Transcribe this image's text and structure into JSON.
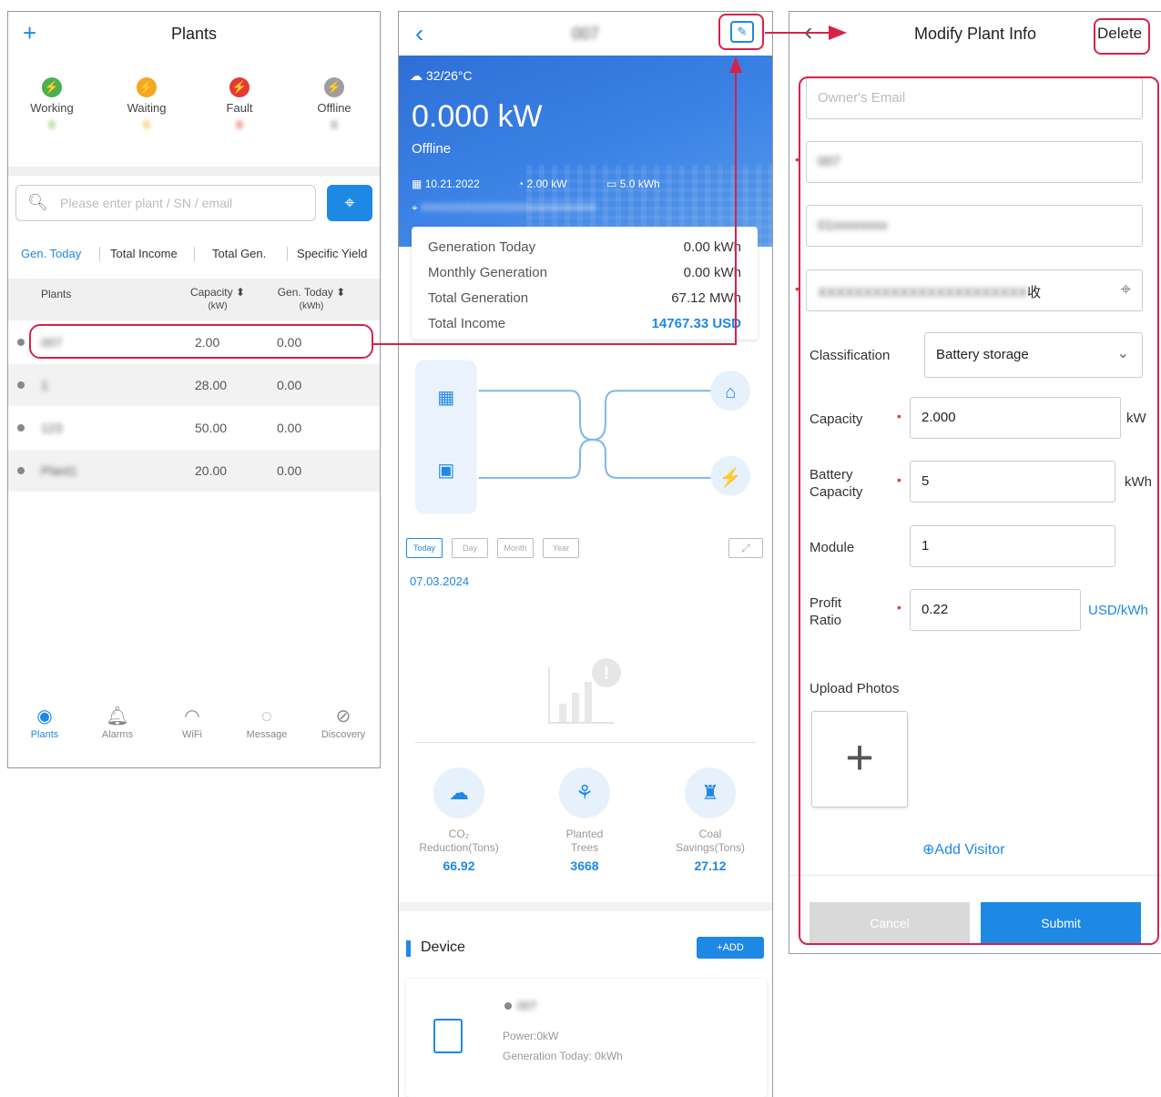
{
  "panel1": {
    "title": "Plants",
    "add_icon": "plus-icon",
    "statuses": [
      {
        "label": "Working",
        "color": "#4caf50",
        "glyph": "⚡"
      },
      {
        "label": "Waiting",
        "color": "#f5a623",
        "glyph": "⚡"
      },
      {
        "label": "Fault",
        "color": "#e53935",
        "glyph": "⚡"
      },
      {
        "label": "Offline",
        "color": "#9e9e9e",
        "glyph": "⚡"
      }
    ],
    "search_placeholder": "Please enter plant / SN / email",
    "tabs": [
      "Gen. Today",
      "Total Income",
      "Total Gen.",
      "Specific Yield"
    ],
    "columns": {
      "plants": "Plants",
      "capacity": "Capacity ⬍",
      "capacity_unit": "(kW)",
      "gen_today": "Gen. Today ⬍",
      "gen_unit": "(kWh)"
    },
    "rows": [
      {
        "name": "007",
        "capacity": "2.00",
        "gen": "0.00"
      },
      {
        "name": "1",
        "capacity": "28.00",
        "gen": "0.00"
      },
      {
        "name": "123",
        "capacity": "50.00",
        "gen": "0.00"
      },
      {
        "name": "Plant1",
        "capacity": "20.00",
        "gen": "0.00"
      }
    ],
    "nav": [
      "Plants",
      "Alarms",
      "WiFi",
      "Message",
      "Discovery"
    ]
  },
  "panel2": {
    "plant_name": "007",
    "weather": "32/26°C",
    "power": "0.000 kW",
    "status": "Offline",
    "date": "10.21.2022",
    "capacity": "2.00 kW",
    "battery": "5.0 kWh",
    "address": "XXXXXXXXXXXXXXXXXXXXXXXX",
    "stats": [
      {
        "label": "Generation Today",
        "value": "0.00 kWh"
      },
      {
        "label": "Monthly Generation",
        "value": "0.00 kWh"
      },
      {
        "label": "Total Generation",
        "value": "67.12 MWh"
      },
      {
        "label": "Total Income",
        "value": "14767.33 USD"
      }
    ],
    "chips": [
      "Today",
      "Day",
      "Month",
      "Year"
    ],
    "chart_date": "07.03.2024",
    "env": [
      {
        "label1": "CO₂",
        "label2": "Reduction(Tons)",
        "value": "66.92"
      },
      {
        "label1": "Planted",
        "label2": "Trees",
        "value": "3668"
      },
      {
        "label1": "Coal",
        "label2": "Savings(Tons)",
        "value": "27.12"
      }
    ],
    "device_title": "Device",
    "add_label": "ADD",
    "device_name": "007",
    "device_power": "Power:0kW",
    "device_gen": "Generation Today: 0kWh"
  },
  "panel3": {
    "title": "Modify Plant Info",
    "delete_label": "Delete",
    "email_placeholder": "Owner's Email",
    "plant_name": "007",
    "phone": "01xxxxxxxx",
    "address": "XXXXXXXXXXXXXXXXXXXXXXX",
    "address_suffix": "收",
    "classification_label": "Classification",
    "classification_value": "Battery storage",
    "capacity_label": "Capacity",
    "capacity_value": "2.000",
    "capacity_unit": "kW",
    "battery_label1": "Battery",
    "battery_label2": "Capacity",
    "battery_value": "5",
    "battery_unit": "kWh",
    "module_label": "Module",
    "module_value": "1",
    "profit_label1": "Profit",
    "profit_label2": "Ratio",
    "profit_value": "0.22",
    "profit_unit": "USD/kWh",
    "upload_label": "Upload Photos",
    "add_visitor": "Add Visitor",
    "cancel_label": "Cancel",
    "submit_label": "Submit"
  },
  "colors": {
    "accent": "#1e88e5",
    "highlight": "#d6224a"
  }
}
